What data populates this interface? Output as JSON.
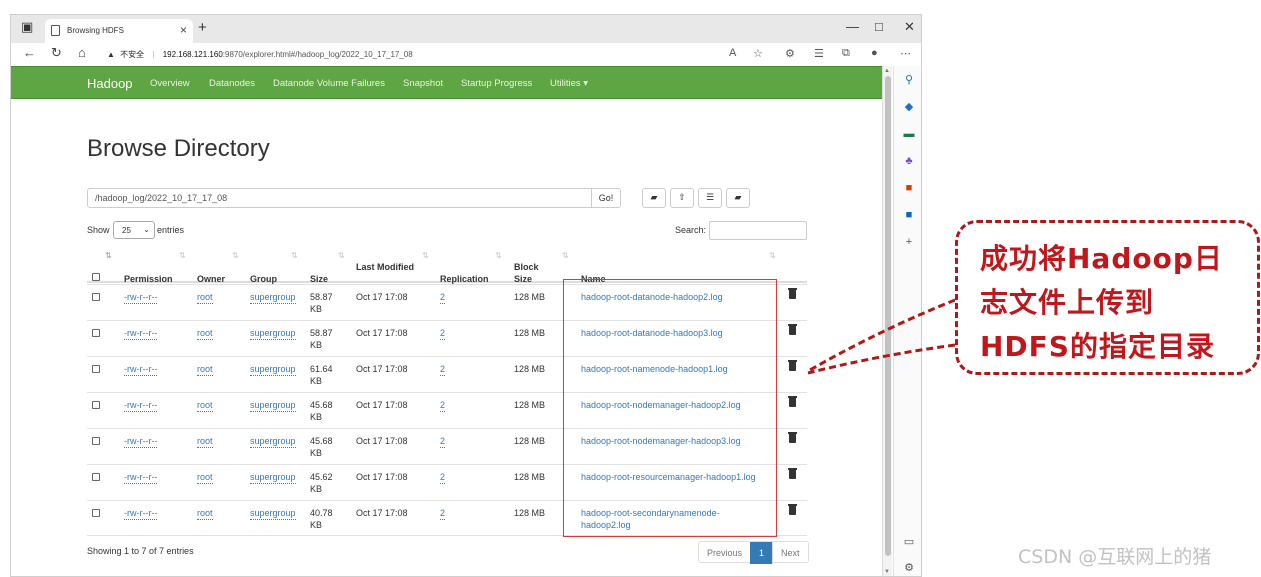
{
  "window": {
    "minimize": "—",
    "maximize": "□",
    "close": "✕"
  },
  "tab": {
    "title": "Browsing HDFS",
    "close": "×",
    "new": "+"
  },
  "address": {
    "warning_icon": "▲",
    "warning_text": "不安全",
    "host": "192.168.121.160",
    "rest": ":9870/explorer.html#/hadoop_log/2022_10_17_17_08"
  },
  "navbar": {
    "brand": "Hadoop",
    "items": [
      "Overview",
      "Datanodes",
      "Datanode Volume Failures",
      "Snapshot",
      "Startup Progress",
      "Utilities ▾"
    ]
  },
  "page": {
    "title": "Browse Directory",
    "path": "/hadoop_log/2022_10_17_17_08",
    "go_label": "Go!",
    "show_label": "Show",
    "entries_value": "25",
    "entries_label": "entries",
    "search_label": "Search:"
  },
  "table": {
    "headers": {
      "permission": "Permission",
      "owner": "Owner",
      "group": "Group",
      "size": "Size",
      "last_modified": "Last Modified",
      "replication": "Replication",
      "block_size": "Block Size",
      "name": "Name"
    },
    "rows": [
      {
        "perm": "-rw-r--r--",
        "owner": "root",
        "group": "supergroup",
        "size1": "58.87",
        "size2": "KB",
        "modified": "Oct 17 17:08",
        "rep": "2",
        "block": "128 MB",
        "name1": "hadoop-root-datanode-hadoop2.log",
        "name2": ""
      },
      {
        "perm": "-rw-r--r--",
        "owner": "root",
        "group": "supergroup",
        "size1": "58.87",
        "size2": "KB",
        "modified": "Oct 17 17:08",
        "rep": "2",
        "block": "128 MB",
        "name1": "hadoop-root-datanode-hadoop3.log",
        "name2": ""
      },
      {
        "perm": "-rw-r--r--",
        "owner": "root",
        "group": "supergroup",
        "size1": "61.64",
        "size2": "KB",
        "modified": "Oct 17 17:08",
        "rep": "2",
        "block": "128 MB",
        "name1": "hadoop-root-namenode-hadoop1.log",
        "name2": ""
      },
      {
        "perm": "-rw-r--r--",
        "owner": "root",
        "group": "supergroup",
        "size1": "45.68",
        "size2": "KB",
        "modified": "Oct 17 17:08",
        "rep": "2",
        "block": "128 MB",
        "name1": "hadoop-root-nodemanager-hadoop2.log",
        "name2": ""
      },
      {
        "perm": "-rw-r--r--",
        "owner": "root",
        "group": "supergroup",
        "size1": "45.68",
        "size2": "KB",
        "modified": "Oct 17 17:08",
        "rep": "2",
        "block": "128 MB",
        "name1": "hadoop-root-nodemanager-hadoop3.log",
        "name2": ""
      },
      {
        "perm": "-rw-r--r--",
        "owner": "root",
        "group": "supergroup",
        "size1": "45.62",
        "size2": "KB",
        "modified": "Oct 17 17:08",
        "rep": "2",
        "block": "128 MB",
        "name1": "hadoop-root-resourcemanager-hadoop1.log",
        "name2": ""
      },
      {
        "perm": "-rw-r--r--",
        "owner": "root",
        "group": "supergroup",
        "size1": "40.78",
        "size2": "KB",
        "modified": "Oct 17 17:08",
        "rep": "2",
        "block": "128 MB",
        "name1": "hadoop-root-secondarynamenode-",
        "name2": "hadoop2.log"
      }
    ]
  },
  "footer": {
    "info": "Showing 1 to 7 of 7 entries",
    "prev": "Previous",
    "page": "1",
    "next": "Next"
  },
  "annotation": {
    "lines": [
      "成功将Hadoop日",
      "志文件上传到",
      "HDFS的指定目录"
    ]
  },
  "watermark": "CSDN @互联网上的猪",
  "colors": {
    "navbar": "#5ea543",
    "link": "#337ab7",
    "annotation": "#c0171c"
  }
}
